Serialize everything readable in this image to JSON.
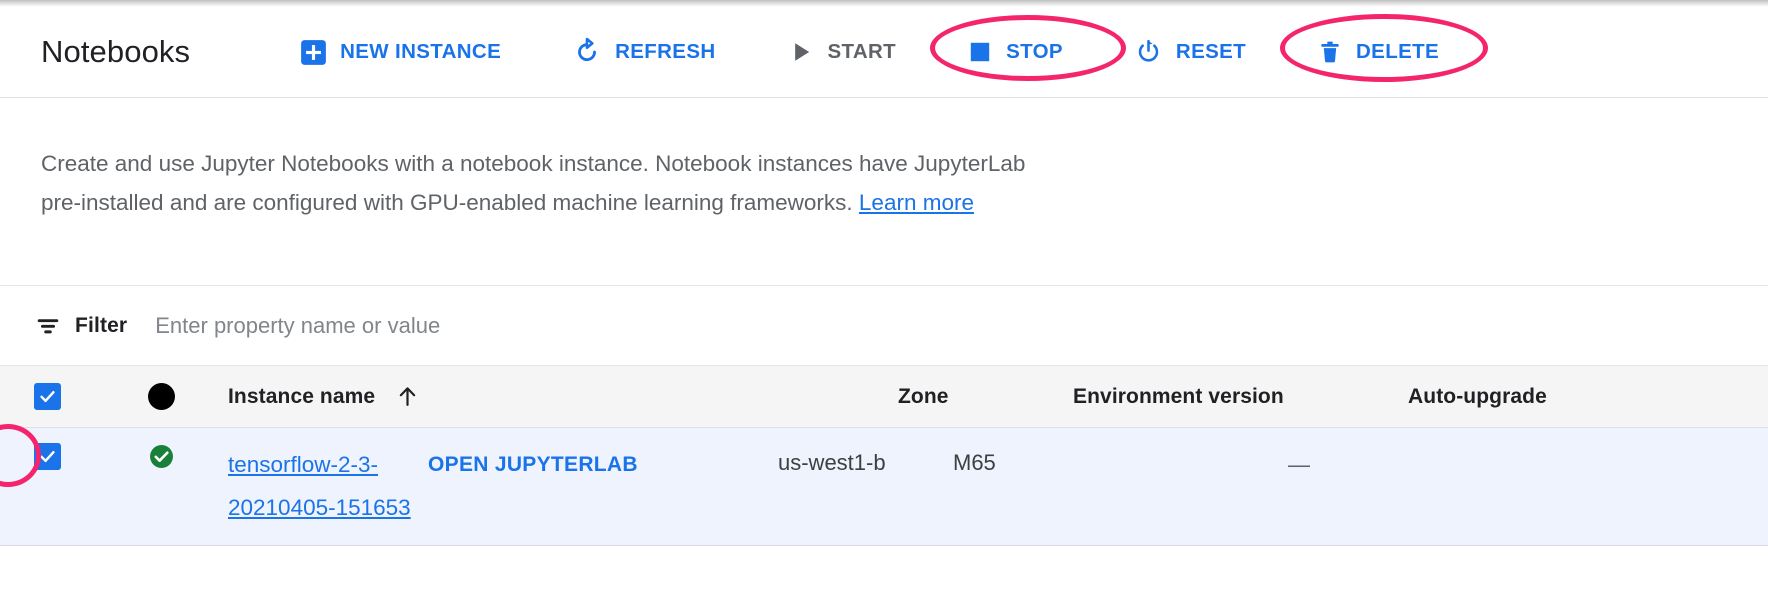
{
  "header": {
    "title": "Notebooks",
    "toolbar": [
      {
        "id": "new-instance",
        "label": "NEW INSTANCE",
        "icon": "plus-box-icon",
        "state": "enabled",
        "annotated": false
      },
      {
        "id": "refresh",
        "label": "REFRESH",
        "icon": "refresh-icon",
        "state": "enabled",
        "annotated": false
      },
      {
        "id": "start",
        "label": "START",
        "icon": "play-icon",
        "state": "disabled",
        "annotated": false
      },
      {
        "id": "stop",
        "label": "STOP",
        "icon": "stop-square-icon",
        "state": "enabled",
        "annotated": true
      },
      {
        "id": "reset",
        "label": "RESET",
        "icon": "power-reset-icon",
        "state": "enabled",
        "annotated": false
      },
      {
        "id": "delete",
        "label": "DELETE",
        "icon": "trash-icon",
        "state": "enabled",
        "annotated": true
      }
    ]
  },
  "description": {
    "text": "Create and use Jupyter Notebooks with a notebook instance. Notebook instances have JupyterLab pre-installed and are configured with GPU-enabled machine learning frameworks. ",
    "link_label": "Learn more"
  },
  "filter": {
    "icon": "filter-icon",
    "label": "Filter",
    "placeholder": "Enter property name or value",
    "value": ""
  },
  "table": {
    "select_all_checked": true,
    "columns": [
      {
        "id": "checkbox",
        "label": ""
      },
      {
        "id": "status",
        "label": ""
      },
      {
        "id": "name",
        "label": "Instance name",
        "sort": "ascending",
        "sort_icon": "arrow-up-icon"
      },
      {
        "id": "open",
        "label": ""
      },
      {
        "id": "zone",
        "label": "Zone"
      },
      {
        "id": "env",
        "label": "Environment version"
      },
      {
        "id": "auto",
        "label": "Auto-upgrade"
      }
    ],
    "rows": [
      {
        "checked": true,
        "checkbox_annotated": true,
        "status": "running",
        "status_icon": "green-check-circle-icon",
        "name": "tensorflow-2-3-20210405-151653",
        "open_label": "OPEN JUPYTERLAB",
        "zone": "us-west1-b",
        "environment_version": "M65",
        "auto_upgrade": "—"
      }
    ]
  },
  "colors": {
    "accent_blue": "#1a73e8",
    "annotation_pink": "#f4256c",
    "status_green": "#188038",
    "row_selected_bg": "#eef3fd",
    "header_row_bg": "#f5f5f5",
    "text_primary": "#202124",
    "text_secondary": "#5f6368"
  }
}
